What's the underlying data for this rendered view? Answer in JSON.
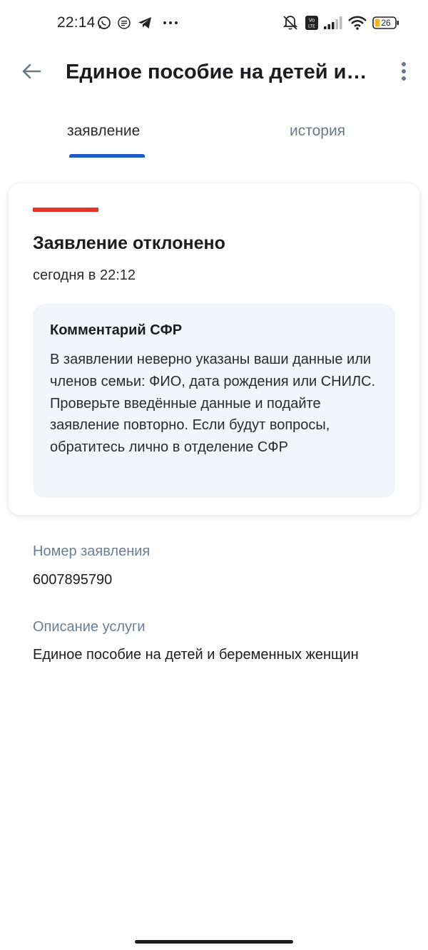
{
  "status_bar": {
    "time": "22:14",
    "battery_level": "26",
    "icons_left": [
      "whatsapp-icon",
      "app-badge-icon",
      "telegram-icon",
      "more-dots-icon"
    ],
    "icons_right": [
      "mute-icon",
      "volte-icon",
      "signal-icon",
      "wifi-icon",
      "battery-icon"
    ]
  },
  "app_bar": {
    "title": "Единое пособие на детей и беременных женщин",
    "back_icon": "arrow-left-icon",
    "menu_icon": "more-vertical-icon"
  },
  "tabs": [
    {
      "label": "заявление",
      "active": true
    },
    {
      "label": "история",
      "active": false
    }
  ],
  "status_card": {
    "stripe_color": "#e3332b",
    "title": "Заявление отклонено",
    "time": "сегодня в 22:12",
    "comment": {
      "title": "Комментарий СФР",
      "text": "В заявлении неверно указаны ваши данные или членов семьи: ФИО, дата рождения или СНИЛС. Проверьте введённые данные и подайте заявление повторно. Если будут вопросы, обратитесь лично в отделение СФР"
    }
  },
  "details": [
    {
      "label": "Номер заявления",
      "value": "6007895790"
    },
    {
      "label": "Описание услуги",
      "value": "Единое пособие на детей и беременных женщин"
    }
  ],
  "colors": {
    "accent": "#1d5cc2",
    "rejected": "#e3332b",
    "label_gray": "#6b7d94",
    "comment_bg": "#f2f5fa"
  }
}
